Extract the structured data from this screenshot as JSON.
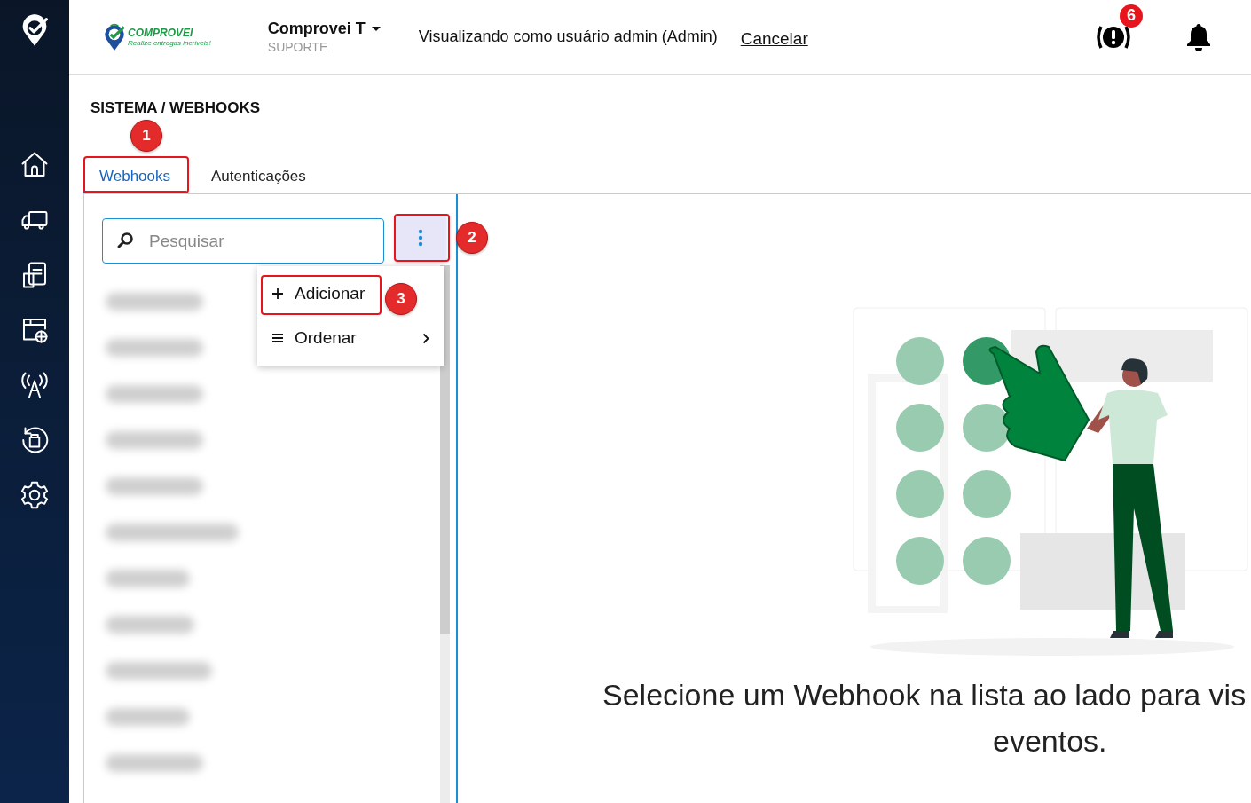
{
  "header": {
    "logo": {
      "name": "COMPROVEI",
      "tagline": "Realize entregas incríveis!"
    },
    "account": {
      "name": "Comprovei T",
      "role": "SUPORTE"
    },
    "impersonation": {
      "text": "Visualizando como usuário admin (Admin)",
      "cancel_link": "Cancelar"
    },
    "alerts_badge": "6"
  },
  "breadcrumb": "SISTEMA / WEBHOOKS",
  "tabs": [
    {
      "label": "Webhooks",
      "selected": true
    },
    {
      "label": "Autenticações",
      "selected": false
    }
  ],
  "search": {
    "placeholder": "Pesquisar"
  },
  "menu": {
    "items": [
      {
        "kind": "add",
        "label": "Adicionar"
      },
      {
        "kind": "submenu",
        "label": "Ordenar"
      }
    ]
  },
  "webhook_list": [
    {
      "kind": "redacted"
    },
    {
      "kind": "redacted"
    },
    {
      "kind": "redacted"
    },
    {
      "kind": "redacted"
    },
    {
      "kind": "redacted"
    },
    {
      "kind": "redacted"
    },
    {
      "kind": "redacted"
    },
    {
      "kind": "redacted"
    },
    {
      "kind": "redacted"
    },
    {
      "kind": "redacted"
    },
    {
      "kind": "redacted"
    }
  ],
  "empty_state": {
    "lines": [
      "Selecione um Webhook na lista ao lado para vis",
      "eventos."
    ]
  },
  "annotations": [
    {
      "kind": "tab",
      "label": "1"
    },
    {
      "kind": "button",
      "label": "2"
    },
    {
      "kind": "menu_item",
      "label": "3"
    }
  ]
}
